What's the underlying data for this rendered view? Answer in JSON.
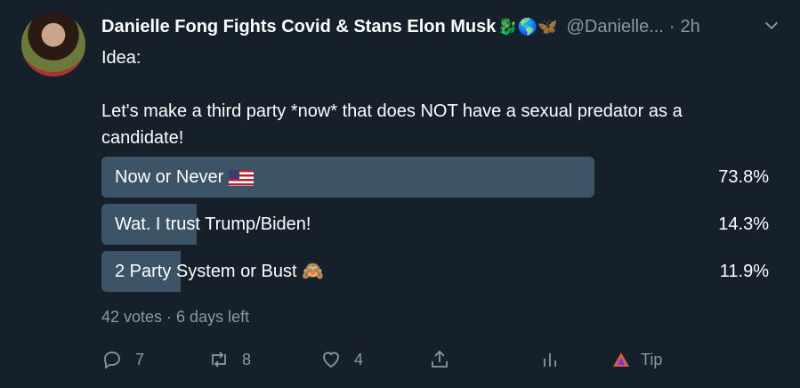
{
  "author": {
    "name": "Danielle Fong Fights Covid & Stans Elon Musk",
    "emojis": "🐉🌎🦋",
    "handle": "@Danielle...",
    "separator": "·",
    "time": "2h"
  },
  "tweet": {
    "line1": "Idea:",
    "line2": "Let's make a third party *now* that does NOT have a sexual predator as a candidate!"
  },
  "poll": {
    "options": [
      {
        "label": "Now or Never",
        "emoji": "flag-us",
        "percent_text": "73.8%",
        "percent": 73.8
      },
      {
        "label": "Wat. I trust Trump/Biden!",
        "emoji": "",
        "percent_text": "14.3%",
        "percent": 14.3
      },
      {
        "label": "2 Party System or Bust",
        "emoji": "🙈",
        "percent_text": "11.9%",
        "percent": 11.9
      }
    ],
    "meta": "42 votes · 6 days left"
  },
  "actions": {
    "reply_count": "7",
    "retweet_count": "8",
    "like_count": "4",
    "tip_label": "Tip"
  },
  "colors": {
    "background": "#15202b",
    "bar": "#3d5466",
    "muted": "#8899a6",
    "tip": "#e0584a"
  }
}
